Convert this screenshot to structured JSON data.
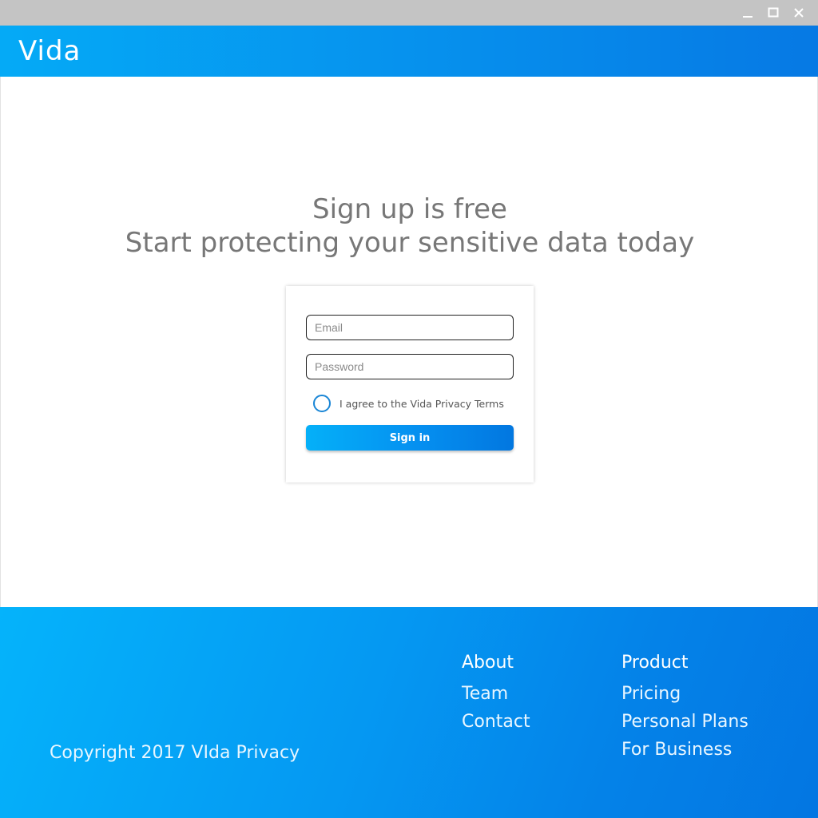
{
  "window": {
    "minimize_icon": "minimize-icon",
    "maximize_icon": "maximize-icon",
    "close_icon": "close-icon"
  },
  "header": {
    "logo": "Vida"
  },
  "main": {
    "headline_1": "Sign up is free",
    "headline_2": "Start protecting your sensitive data today"
  },
  "form": {
    "email_placeholder": "Email",
    "email_value": "",
    "password_placeholder": "Password",
    "password_value": "",
    "agree_label": "I agree to the Vida Privacy Terms",
    "agree_checked": false,
    "submit_label": "Sign in"
  },
  "footer": {
    "copyright": "Copyright 2017 VIda Privacy",
    "about": {
      "heading": "About",
      "links": [
        "Team",
        "Contact"
      ]
    },
    "product": {
      "heading": "Product",
      "links": [
        "Pricing",
        "Personal Plans",
        "For Business"
      ]
    }
  },
  "colors": {
    "brand": "#0596f1",
    "brand_light": "#05b0f8",
    "brand_dark": "#0277e0",
    "heading_text": "#777777",
    "titlebar": "#c4c4c4"
  }
}
